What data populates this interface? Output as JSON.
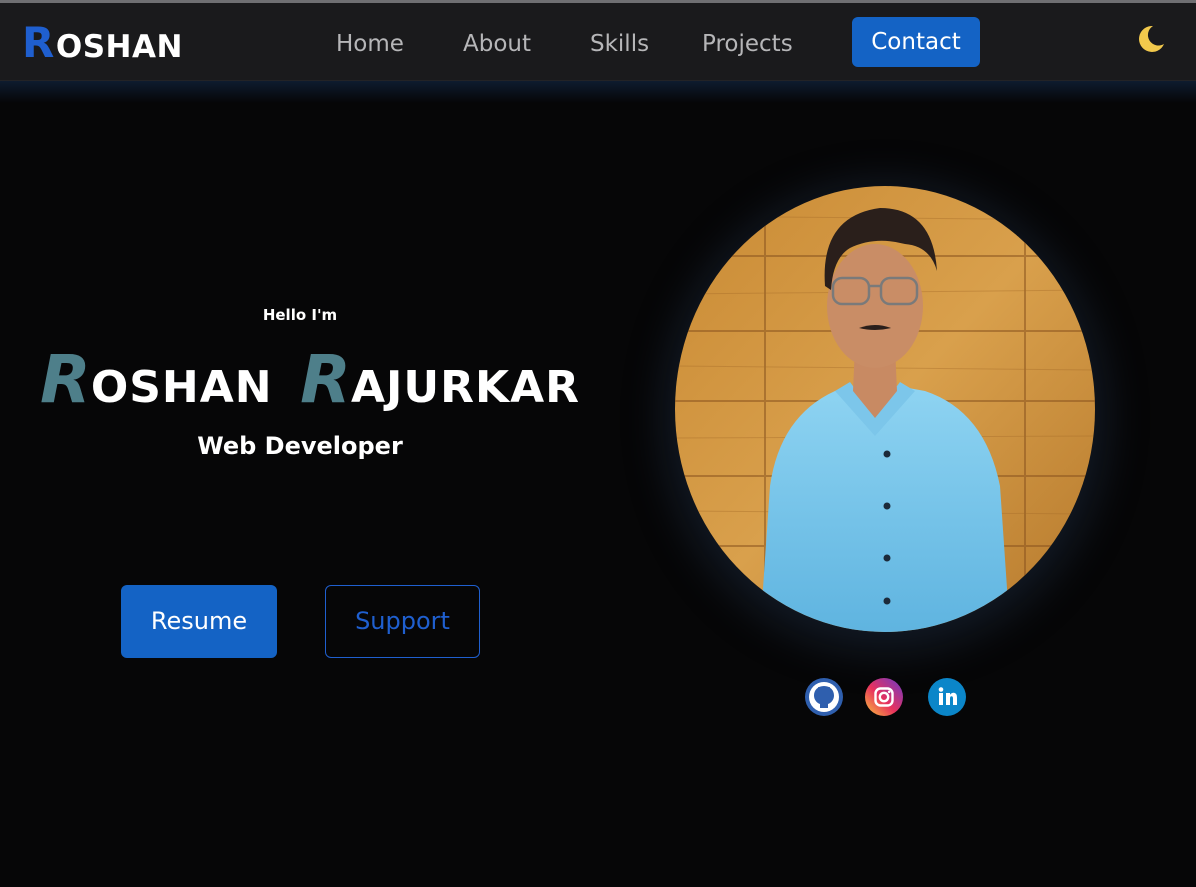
{
  "navbar": {
    "logo_first": "R",
    "logo_rest": "OSHAN",
    "links": [
      "Home",
      "About",
      "Skills",
      "Projects"
    ],
    "contact_label": "Contact",
    "theme_toggle_icon": "moon-icon"
  },
  "hero": {
    "greeting": "Hello I'm",
    "first_initial": "R",
    "first_rest": "OSHAN",
    "last_initial": "R",
    "last_rest": "AJURKAR",
    "role": "Web Developer",
    "resume_label": "Resume",
    "support_label": "Support"
  },
  "profile": {
    "photo": "profile-photo",
    "social_icons": [
      "github-icon",
      "instagram-icon",
      "linkedin-icon"
    ]
  },
  "colors": {
    "accent": "#1463c5",
    "initial": "#4e7f8a",
    "moon": "#f2c94c",
    "background": "#060607",
    "navbar": "#1a1a1c"
  }
}
